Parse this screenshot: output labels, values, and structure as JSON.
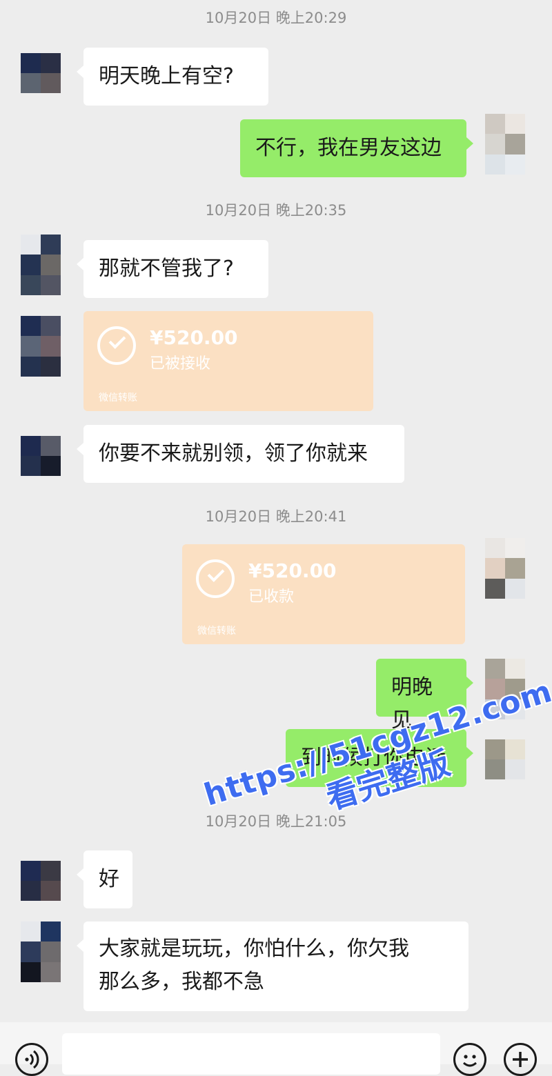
{
  "messages": {
    "ts1": "10月20日 晚上20:29",
    "m1": "明天晚上有空?",
    "m2": "不行，我在男友这边",
    "ts2": "10月20日 晚上20:35",
    "m3": "那就不管我了?",
    "transfer1": {
      "amount": "¥520.00",
      "status": "已被接收",
      "label": "微信转账"
    },
    "m4": "你要不来就别领，领了你就来",
    "ts3": "10月20日 晚上20:41",
    "transfer2": {
      "amount": "¥520.00",
      "status": "已收款",
      "label": "微信转账"
    },
    "m5": "明晚见",
    "m6": "到时候打你电话",
    "ts4": "10月20日 晚上21:05",
    "m7": "好",
    "m8_line1": "大家就是玩玩，你怕什么，你欠我",
    "m8_line2": "那么多，我都不急"
  },
  "watermark": {
    "url": "https://51cgz12.com",
    "text": "看完整版"
  },
  "icons": [
    "voice-icon",
    "emoji-icon",
    "plus-icon"
  ],
  "colors": {
    "bg": "#ededed",
    "sent": "#95ec69",
    "received": "#ffffff",
    "transfer": "#fbe0c3",
    "watermark": "#3e6cf0"
  }
}
